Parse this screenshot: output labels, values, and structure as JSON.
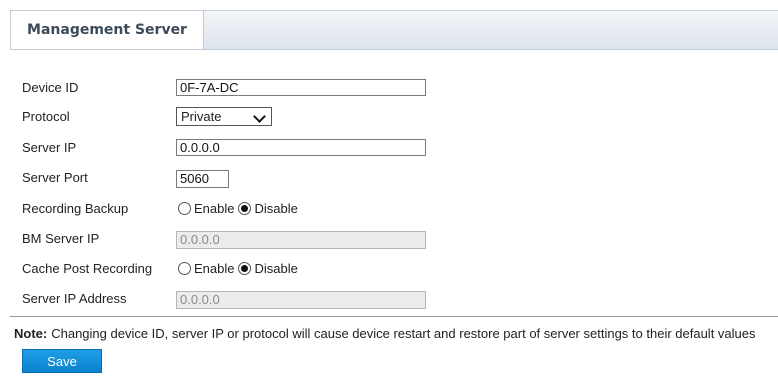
{
  "tab": {
    "label": "Management Server"
  },
  "form": {
    "device_id": {
      "label": "Device ID",
      "value": "0F-7A-DC"
    },
    "protocol": {
      "label": "Protocol",
      "value": "Private"
    },
    "server_ip": {
      "label": "Server IP",
      "value": "0.0.0.0"
    },
    "server_port": {
      "label": "Server Port",
      "value": "5060"
    },
    "recording_backup": {
      "label": "Recording Backup",
      "enable": "Enable",
      "disable": "Disable",
      "selected": "Disable"
    },
    "bm_server_ip": {
      "label": "BM Server IP",
      "value": "0.0.0.0"
    },
    "cache_post_recording": {
      "label": "Cache Post Recording",
      "enable": "Enable",
      "disable": "Disable",
      "selected": "Disable"
    },
    "server_ip_address": {
      "label": "Server IP Address",
      "value": "0.0.0.0"
    }
  },
  "note": {
    "prefix": "Note:",
    "text": "Changing device ID, server IP or protocol will cause device restart and restore part of server settings to their default values"
  },
  "actions": {
    "save_label": "Save"
  },
  "colors": {
    "accent": "#0b82cd",
    "tab_bg": "#dde4ec"
  }
}
